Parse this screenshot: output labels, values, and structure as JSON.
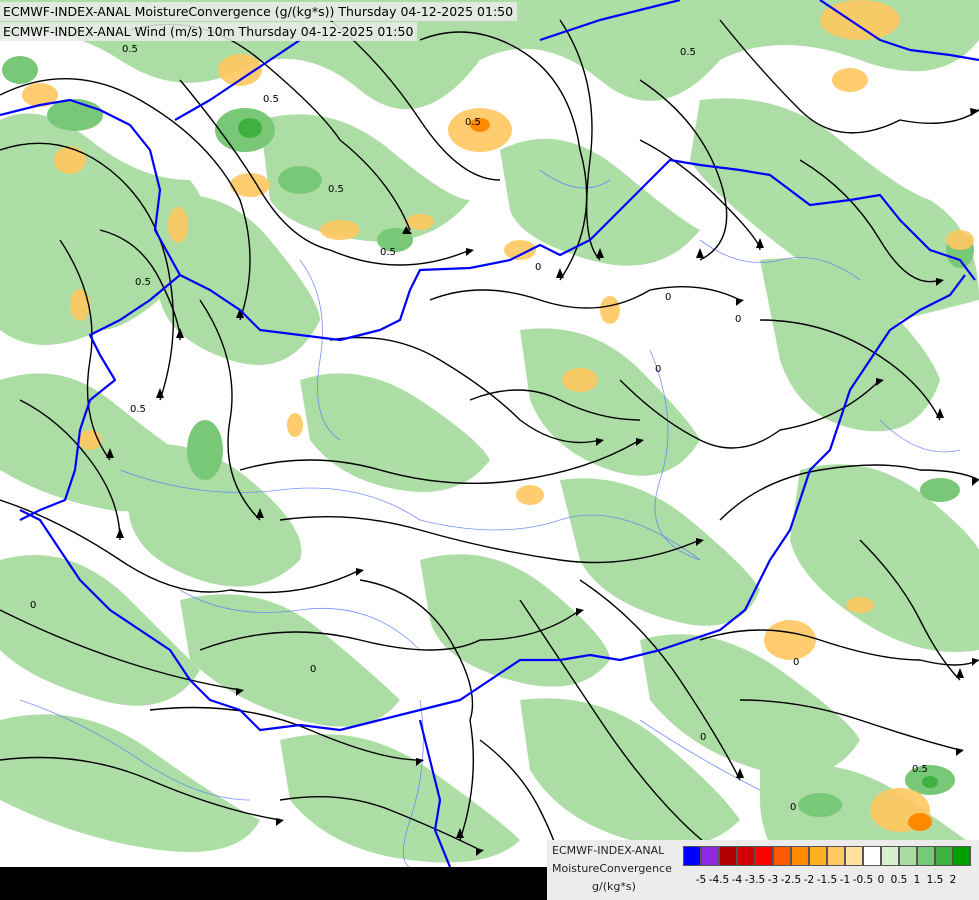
{
  "header": {
    "line1": "ECMWF-INDEX-ANAL MoistureConvergence (g/(kg*s)) Thursday 04-12-2025 01:50",
    "line2": "ECMWF-INDEX-ANAL Wind (m/s) 10m Thursday 04-12-2025 01:50"
  },
  "legend": {
    "line1": "ECMWF-INDEX-ANAL",
    "line2": "MoistureConvergence",
    "units": "g/(kg*s)",
    "colors": [
      "#0000ff",
      "#8a2be2",
      "#b00000",
      "#d40000",
      "#ff0000",
      "#ff5a00",
      "#ff8a00",
      "#ffb020",
      "#ffc860",
      "#ffe0a0",
      "#ffffff",
      "#d8f0d0",
      "#a8dca0",
      "#78c878",
      "#40b040",
      "#00a000"
    ],
    "ticks": [
      "-5",
      "-4.5",
      "-4",
      "-3.5",
      "-3",
      "-2.5",
      "-2",
      "-1.5",
      "-1",
      "-0.5",
      "0",
      "0.5",
      "1",
      "1.5",
      "2"
    ]
  },
  "contour_labels": [
    "0.5",
    "0.5",
    "0.5",
    "0.5",
    "0.5",
    "0.5",
    "0.5",
    "0.5",
    "0",
    "0",
    "0",
    "0",
    "0",
    "0",
    "0",
    "0",
    "0",
    "0.5"
  ],
  "colors": {
    "land_base": "#ffffff",
    "green_light": "#a8dca0",
    "green_mid": "#78c878",
    "green_dark": "#40b040",
    "orange_light": "#ffc860",
    "orange_mid": "#ff8a00",
    "border": "#0000ff",
    "river": "#5a78ff",
    "streamline": "#000000"
  }
}
